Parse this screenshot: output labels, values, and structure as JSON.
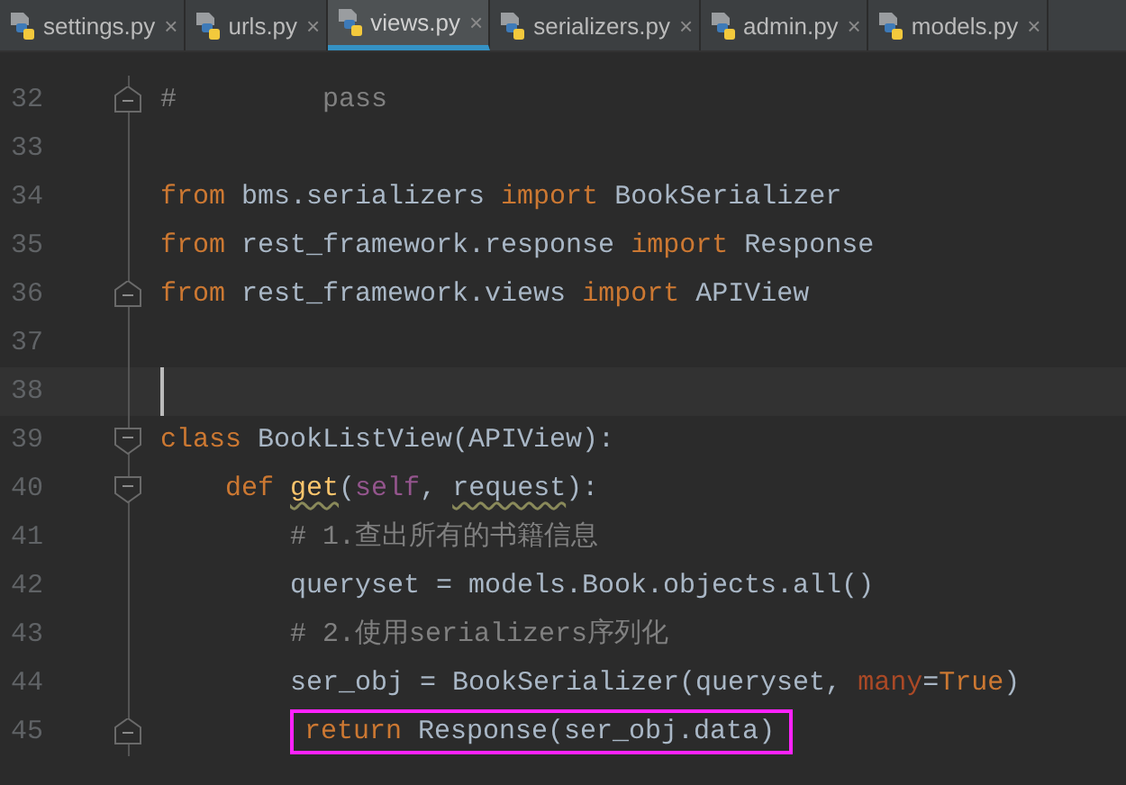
{
  "tabs": [
    {
      "label": "settings.py",
      "selected": false
    },
    {
      "label": "urls.py",
      "selected": false
    },
    {
      "label": "views.py",
      "selected": true
    },
    {
      "label": "serializers.py",
      "selected": false
    },
    {
      "label": "admin.py",
      "selected": false
    },
    {
      "label": "models.py",
      "selected": false
    }
  ],
  "close_glyph": "×",
  "editor": {
    "lines": [
      {
        "number": "32",
        "fold_end": true,
        "tokens": [
          {
            "kind": "comment",
            "text": "#         pass"
          }
        ]
      },
      {
        "number": "33"
      },
      {
        "number": "34",
        "tokens": [
          {
            "kind": "keyword",
            "text": "from"
          },
          {
            "kind": "plain",
            "text": " bms.serializers "
          },
          {
            "kind": "keyword",
            "text": "import"
          },
          {
            "kind": "plain",
            "text": " BookSerializer"
          }
        ]
      },
      {
        "number": "35",
        "tokens": [
          {
            "kind": "keyword",
            "text": "from"
          },
          {
            "kind": "plain",
            "text": " rest_framework.response "
          },
          {
            "kind": "keyword",
            "text": "import"
          },
          {
            "kind": "plain",
            "text": " Response"
          }
        ]
      },
      {
        "number": "36",
        "fold_end": true,
        "tokens": [
          {
            "kind": "keyword",
            "text": "from"
          },
          {
            "kind": "plain",
            "text": " rest_framework.views "
          },
          {
            "kind": "keyword",
            "text": "import"
          },
          {
            "kind": "plain",
            "text": " APIView"
          }
        ]
      },
      {
        "number": "37"
      },
      {
        "number": "38",
        "current": true
      },
      {
        "number": "39",
        "fold_start": true,
        "tokens": [
          {
            "kind": "keyword",
            "text": "class"
          },
          {
            "kind": "plain",
            "text": " BookListView(APIView):"
          }
        ]
      },
      {
        "number": "40",
        "fold_start": true,
        "tokens": [
          {
            "kind": "keyword",
            "text": "    def "
          },
          {
            "kind": "function",
            "text": "get",
            "underlined": true
          },
          {
            "kind": "plain",
            "text": "("
          },
          {
            "kind": "self",
            "text": "self"
          },
          {
            "kind": "plain",
            "text": ", "
          },
          {
            "kind": "plain",
            "text": "request",
            "underlined": true
          },
          {
            "kind": "plain",
            "text": "):"
          }
        ]
      },
      {
        "number": "41",
        "tokens": [
          {
            "kind": "comment",
            "text": "        # 1.查出所有的书籍信息"
          }
        ]
      },
      {
        "number": "42",
        "tokens": [
          {
            "kind": "plain",
            "text": "        queryset = models.Book.objects.all()"
          }
        ]
      },
      {
        "number": "43",
        "tokens": [
          {
            "kind": "comment",
            "text": "        # 2.使用serializers序列化"
          }
        ]
      },
      {
        "number": "44",
        "tokens": [
          {
            "kind": "plain",
            "text": "        ser_obj = BookSerializer(queryset, "
          },
          {
            "kind": "kwarg",
            "text": "many"
          },
          {
            "kind": "plain",
            "text": "="
          },
          {
            "kind": "keyword",
            "text": "True"
          },
          {
            "kind": "plain",
            "text": ")"
          }
        ]
      },
      {
        "number": "45",
        "fold_end": true,
        "highlighted": true,
        "tokens": [
          {
            "kind": "keyword",
            "text": "        return"
          },
          {
            "kind": "plain",
            "text": " Response(ser_obj.data)"
          }
        ]
      }
    ]
  }
}
